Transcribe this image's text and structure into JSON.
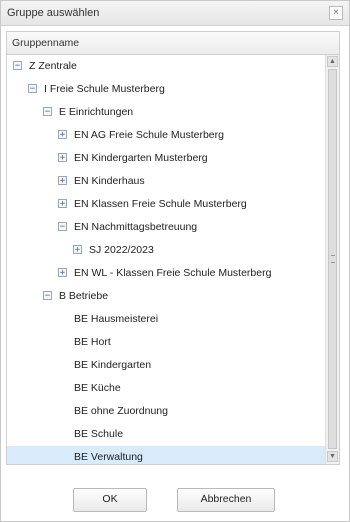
{
  "dialog": {
    "title": "Gruppe auswählen",
    "close_glyph": "×"
  },
  "tree": {
    "column_header": "Gruppenname",
    "selected_index": 17,
    "rows": [
      {
        "label": "Z Zentrale",
        "level": 0,
        "toggle": "⊟"
      },
      {
        "label": "I Freie Schule Musterberg",
        "level": 1,
        "toggle": "⊟"
      },
      {
        "label": "E Einrichtungen",
        "level": 2,
        "toggle": "⊟"
      },
      {
        "label": "EN AG Freie Schule Musterberg",
        "level": 3,
        "toggle": "⊞"
      },
      {
        "label": "EN Kindergarten Musterberg",
        "level": 3,
        "toggle": "⊞"
      },
      {
        "label": "EN Kinderhaus",
        "level": 3,
        "toggle": "⊞"
      },
      {
        "label": "EN Klassen Freie Schule Musterberg",
        "level": 3,
        "toggle": "⊞"
      },
      {
        "label": "EN Nachmittagsbetreuung",
        "level": 3,
        "toggle": "⊟"
      },
      {
        "label": "SJ 2022/2023",
        "level": 4,
        "toggle": "⊞"
      },
      {
        "label": "EN WL - Klassen Freie Schule Musterberg",
        "level": 3,
        "toggle": "⊞"
      },
      {
        "label": "B Betriebe",
        "level": 2,
        "toggle": "⊟"
      },
      {
        "label": "BE Hausmeisterei",
        "level": 3,
        "toggle": ""
      },
      {
        "label": "BE Hort",
        "level": 3,
        "toggle": ""
      },
      {
        "label": "BE Kindergarten",
        "level": 3,
        "toggle": ""
      },
      {
        "label": "BE Küche",
        "level": 3,
        "toggle": ""
      },
      {
        "label": "BE ohne Zuordnung",
        "level": 3,
        "toggle": ""
      },
      {
        "label": "BE Schule",
        "level": 3,
        "toggle": ""
      },
      {
        "label": "BE Verwaltung",
        "level": 3,
        "toggle": ""
      }
    ]
  },
  "scrollbar": {
    "up_glyph": "▲",
    "down_glyph": "▼"
  },
  "buttons": {
    "ok": "OK",
    "cancel": "Abbrechen"
  },
  "colors": {
    "selection": "#d7ebfa"
  }
}
